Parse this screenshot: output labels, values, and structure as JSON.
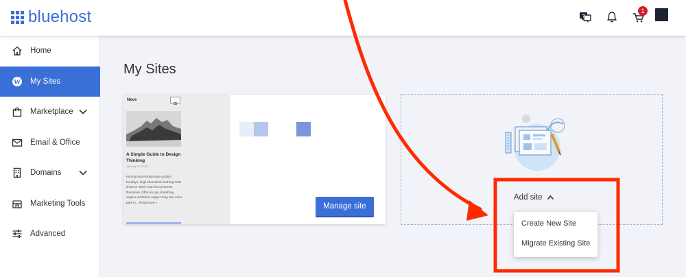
{
  "header": {
    "logo_text": "bluehost",
    "icons": [
      "help-chat-icon",
      "bell-icon",
      "cart-icon"
    ],
    "cart_count": "1",
    "brand_color": "#3b6fd8"
  },
  "sidebar": {
    "items": [
      {
        "label": "Home",
        "icon": "home-icon"
      },
      {
        "label": "My Sites",
        "icon": "wordpress-icon",
        "active": true
      },
      {
        "label": "Marketplace",
        "icon": "shopping-bag-icon",
        "expandable": true
      },
      {
        "label": "Email & Office",
        "icon": "envelope-icon"
      },
      {
        "label": "Domains",
        "icon": "building-icon",
        "expandable": true
      },
      {
        "label": "Marketing Tools",
        "icon": "megaphone-icon"
      },
      {
        "label": "Advanced",
        "icon": "sliders-icon"
      }
    ]
  },
  "main": {
    "title": "My Sites",
    "site_card": {
      "preview": {
        "brand": "Neve",
        "post_title": "A Simple Guide to Design Thinking",
        "post_date": "January 15, 2020",
        "post_excerpt": "Introduction Roodymade godard brooklyn, fixgil shoreditch hashtag hello shamon kitsch man bun pinterest flexitarian. Offal occupy chambray, organic authentic copper mug vice echo park yr... Read More »"
      },
      "manage_button": "Manage site"
    },
    "add_site": {
      "label": "Add site",
      "options": [
        "Create New Site",
        "Migrate Existing Site"
      ]
    }
  },
  "annotation": {
    "color": "#ff2a00"
  }
}
